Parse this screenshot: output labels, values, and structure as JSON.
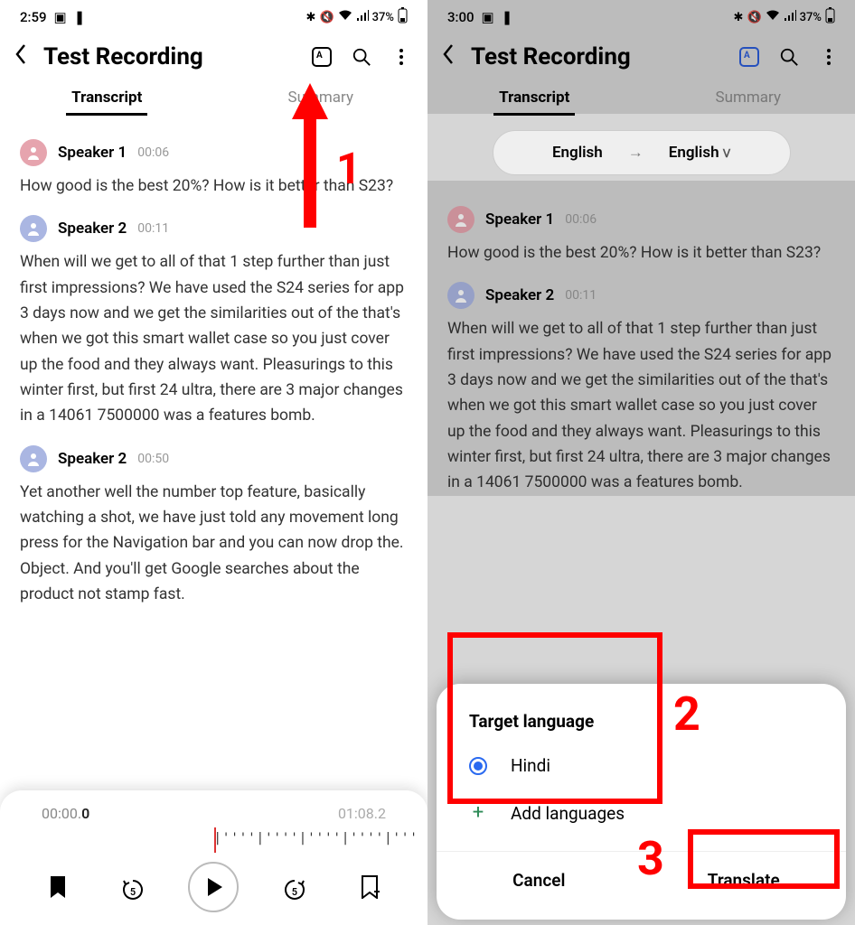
{
  "left": {
    "status": {
      "time": "2:59",
      "battery": "37%"
    },
    "title": "Test Recording",
    "tabs": {
      "transcript": "Transcript",
      "summary": "Summary"
    },
    "blocks": [
      {
        "speaker": "Speaker 1",
        "avatarClass": "av-red",
        "time": "00:06",
        "text": "How good is the best 20%? How is it better than S23?"
      },
      {
        "speaker": "Speaker 2",
        "avatarClass": "av-blue",
        "time": "00:11",
        "text": "When will we get to all of that 1 step further than just first impressions? We have used the S24 series for app 3 days now and we get the similarities out of the that's when we got this smart wallet case so you just cover up the food and they always want. Pleasurings to this winter first, but first 24 ultra, there are 3 major changes in a 14061 7500000 was a features bomb."
      },
      {
        "speaker": "Speaker 2",
        "avatarClass": "av-blue",
        "time": "00:50",
        "text": "Yet another well the number top feature, basically watching a shot, we have just told any movement long press for the Navigation bar and you can now drop the. Object. And you'll get Google searches about the product not stamp fast."
      }
    ],
    "player": {
      "current_prefix": "00:00.",
      "current_bold": "0",
      "total": "01:08.2",
      "bookmark_count": "1"
    },
    "anno_num": "1"
  },
  "right": {
    "status": {
      "time": "3:00",
      "battery": "37%"
    },
    "title": "Test Recording",
    "tabs": {
      "transcript": "Transcript",
      "summary": "Summary"
    },
    "lang": {
      "from": "English",
      "to": "English"
    },
    "blocks": [
      {
        "speaker": "Speaker 1",
        "avatarClass": "av-red",
        "time": "00:06",
        "text": "How good is the best 20%? How is it better than S23?"
      },
      {
        "speaker": "Speaker 2",
        "avatarClass": "av-blue",
        "time": "00:11",
        "text": "When will we get to all of that 1 step further than just first impressions? We have used the S24 series for app 3 days now and we get the similarities out of the that's when we got this smart wallet case so you just cover up the food and they always want. Pleasurings to this winter first, but first 24 ultra, there are 3 major changes in a 14061 7500000 was a features bomb."
      }
    ],
    "sheet": {
      "title": "Target language",
      "option": "Hindi",
      "add": "Add languages",
      "cancel": "Cancel",
      "translate": "Translate"
    },
    "anno2": "2",
    "anno3": "3"
  }
}
